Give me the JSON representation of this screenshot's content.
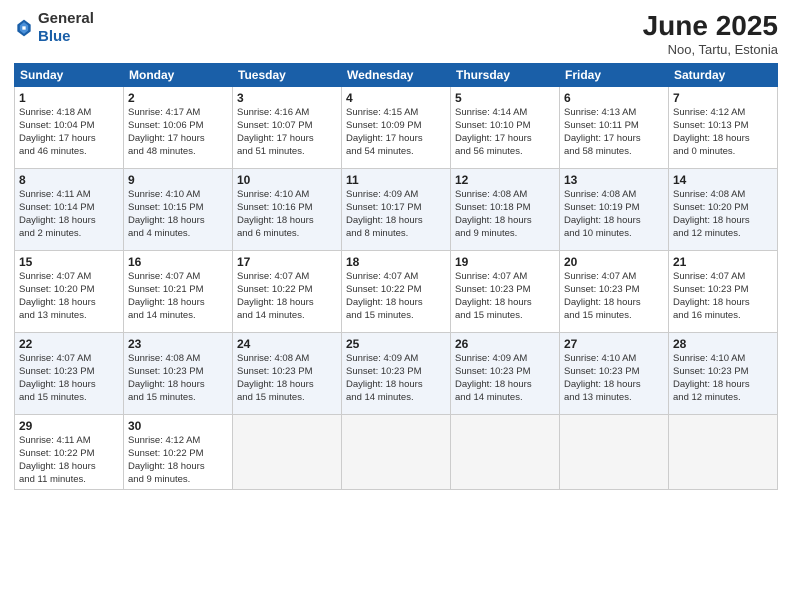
{
  "header": {
    "logo_general": "General",
    "logo_blue": "Blue",
    "month_year": "June 2025",
    "location": "Noo, Tartu, Estonia"
  },
  "days_of_week": [
    "Sunday",
    "Monday",
    "Tuesday",
    "Wednesday",
    "Thursday",
    "Friday",
    "Saturday"
  ],
  "weeks": [
    [
      {
        "day": 1,
        "info": "Sunrise: 4:18 AM\nSunset: 10:04 PM\nDaylight: 17 hours\nand 46 minutes."
      },
      {
        "day": 2,
        "info": "Sunrise: 4:17 AM\nSunset: 10:06 PM\nDaylight: 17 hours\nand 48 minutes."
      },
      {
        "day": 3,
        "info": "Sunrise: 4:16 AM\nSunset: 10:07 PM\nDaylight: 17 hours\nand 51 minutes."
      },
      {
        "day": 4,
        "info": "Sunrise: 4:15 AM\nSunset: 10:09 PM\nDaylight: 17 hours\nand 54 minutes."
      },
      {
        "day": 5,
        "info": "Sunrise: 4:14 AM\nSunset: 10:10 PM\nDaylight: 17 hours\nand 56 minutes."
      },
      {
        "day": 6,
        "info": "Sunrise: 4:13 AM\nSunset: 10:11 PM\nDaylight: 17 hours\nand 58 minutes."
      },
      {
        "day": 7,
        "info": "Sunrise: 4:12 AM\nSunset: 10:13 PM\nDaylight: 18 hours\nand 0 minutes."
      }
    ],
    [
      {
        "day": 8,
        "info": "Sunrise: 4:11 AM\nSunset: 10:14 PM\nDaylight: 18 hours\nand 2 minutes."
      },
      {
        "day": 9,
        "info": "Sunrise: 4:10 AM\nSunset: 10:15 PM\nDaylight: 18 hours\nand 4 minutes."
      },
      {
        "day": 10,
        "info": "Sunrise: 4:10 AM\nSunset: 10:16 PM\nDaylight: 18 hours\nand 6 minutes."
      },
      {
        "day": 11,
        "info": "Sunrise: 4:09 AM\nSunset: 10:17 PM\nDaylight: 18 hours\nand 8 minutes."
      },
      {
        "day": 12,
        "info": "Sunrise: 4:08 AM\nSunset: 10:18 PM\nDaylight: 18 hours\nand 9 minutes."
      },
      {
        "day": 13,
        "info": "Sunrise: 4:08 AM\nSunset: 10:19 PM\nDaylight: 18 hours\nand 10 minutes."
      },
      {
        "day": 14,
        "info": "Sunrise: 4:08 AM\nSunset: 10:20 PM\nDaylight: 18 hours\nand 12 minutes."
      }
    ],
    [
      {
        "day": 15,
        "info": "Sunrise: 4:07 AM\nSunset: 10:20 PM\nDaylight: 18 hours\nand 13 minutes."
      },
      {
        "day": 16,
        "info": "Sunrise: 4:07 AM\nSunset: 10:21 PM\nDaylight: 18 hours\nand 14 minutes."
      },
      {
        "day": 17,
        "info": "Sunrise: 4:07 AM\nSunset: 10:22 PM\nDaylight: 18 hours\nand 14 minutes."
      },
      {
        "day": 18,
        "info": "Sunrise: 4:07 AM\nSunset: 10:22 PM\nDaylight: 18 hours\nand 15 minutes."
      },
      {
        "day": 19,
        "info": "Sunrise: 4:07 AM\nSunset: 10:23 PM\nDaylight: 18 hours\nand 15 minutes."
      },
      {
        "day": 20,
        "info": "Sunrise: 4:07 AM\nSunset: 10:23 PM\nDaylight: 18 hours\nand 15 minutes."
      },
      {
        "day": 21,
        "info": "Sunrise: 4:07 AM\nSunset: 10:23 PM\nDaylight: 18 hours\nand 16 minutes."
      }
    ],
    [
      {
        "day": 22,
        "info": "Sunrise: 4:07 AM\nSunset: 10:23 PM\nDaylight: 18 hours\nand 15 minutes."
      },
      {
        "day": 23,
        "info": "Sunrise: 4:08 AM\nSunset: 10:23 PM\nDaylight: 18 hours\nand 15 minutes."
      },
      {
        "day": 24,
        "info": "Sunrise: 4:08 AM\nSunset: 10:23 PM\nDaylight: 18 hours\nand 15 minutes."
      },
      {
        "day": 25,
        "info": "Sunrise: 4:09 AM\nSunset: 10:23 PM\nDaylight: 18 hours\nand 14 minutes."
      },
      {
        "day": 26,
        "info": "Sunrise: 4:09 AM\nSunset: 10:23 PM\nDaylight: 18 hours\nand 14 minutes."
      },
      {
        "day": 27,
        "info": "Sunrise: 4:10 AM\nSunset: 10:23 PM\nDaylight: 18 hours\nand 13 minutes."
      },
      {
        "day": 28,
        "info": "Sunrise: 4:10 AM\nSunset: 10:23 PM\nDaylight: 18 hours\nand 12 minutes."
      }
    ],
    [
      {
        "day": 29,
        "info": "Sunrise: 4:11 AM\nSunset: 10:22 PM\nDaylight: 18 hours\nand 11 minutes."
      },
      {
        "day": 30,
        "info": "Sunrise: 4:12 AM\nSunset: 10:22 PM\nDaylight: 18 hours\nand 9 minutes."
      },
      null,
      null,
      null,
      null,
      null
    ]
  ]
}
